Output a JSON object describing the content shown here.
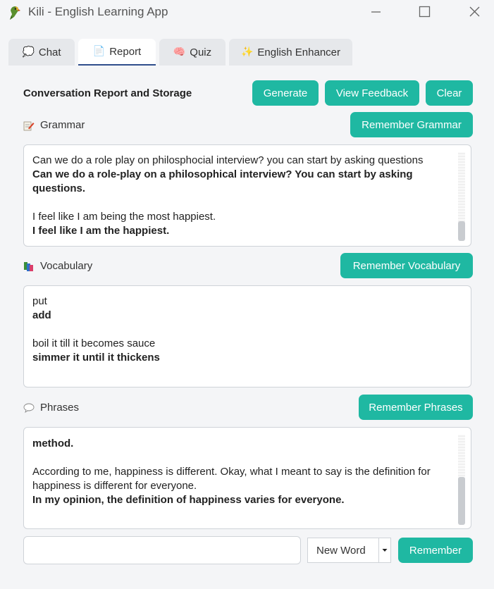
{
  "window": {
    "title": "Kili - English Learning App"
  },
  "tabs": [
    {
      "icon": "💭",
      "label": "Chat"
    },
    {
      "icon": "📄",
      "label": "Report"
    },
    {
      "icon": "🧠",
      "label": "Quiz"
    },
    {
      "icon": "✨",
      "label": "English Enhancer"
    }
  ],
  "active_tab": "Report",
  "report": {
    "title": "Conversation Report and Storage",
    "buttons": {
      "generate": "Generate",
      "view_feedback": "View Feedback",
      "clear": "Clear"
    }
  },
  "grammar": {
    "label": "Grammar",
    "remember_label": "Remember Grammar",
    "lines": [
      "Can we do a role play on philosphocial interview? you can start by asking questions",
      "Can we do a role-play on a philosophical interview? You can start by asking questions.",
      "",
      "I feel like I am being the most happiest.",
      "I feel like I am the happiest."
    ]
  },
  "vocabulary": {
    "label": "Vocabulary",
    "remember_label": "Remember Vocabulary",
    "lines": [
      "put",
      "add",
      "",
      "boil it till it becomes sauce",
      "simmer it until it thickens"
    ]
  },
  "phrases": {
    "label": "Phrases",
    "remember_label": "Remember Phrases",
    "lines": [
      "method.",
      "",
      "According to me, happiness is different. Okay, what I meant to say is the definition for",
      "happiness is different for everyone.",
      "In my opinion, the definition of happiness varies for everyone."
    ]
  },
  "footer": {
    "input_value": "",
    "select_value": "New Word",
    "remember_label": "Remember"
  },
  "colors": {
    "accent": "#1fb8a2",
    "tab_underline": "#2f4e8c"
  }
}
